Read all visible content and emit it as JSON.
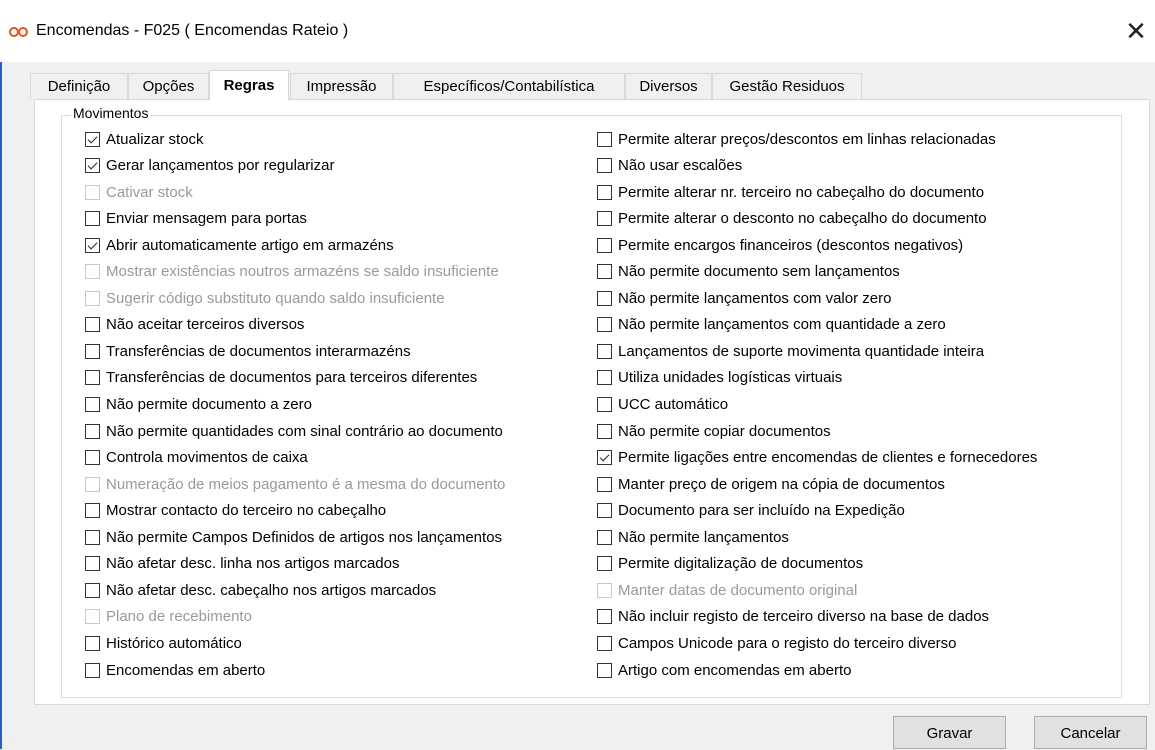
{
  "window": {
    "title": "Encomendas - F025 ( Encomendas Rateio )",
    "close_symbol": "✕"
  },
  "tabs": [
    {
      "label": "Definição",
      "active": false
    },
    {
      "label": "Opções",
      "active": false
    },
    {
      "label": "Regras",
      "active": true
    },
    {
      "label": "Impressão",
      "active": false
    },
    {
      "label": "Específicos/Contabilística",
      "active": false
    },
    {
      "label": "Diversos",
      "active": false
    },
    {
      "label": "Gestão Residuos",
      "active": false
    }
  ],
  "group": {
    "label": "Movimentos"
  },
  "left_options": [
    {
      "label": "Atualizar stock",
      "checked": true,
      "enabled": true
    },
    {
      "label": "Gerar lançamentos por regularizar",
      "checked": true,
      "enabled": true
    },
    {
      "label": "Cativar stock",
      "checked": false,
      "enabled": false
    },
    {
      "label": "Enviar mensagem para portas",
      "checked": false,
      "enabled": true
    },
    {
      "label": "Abrir automaticamente artigo em armazéns",
      "checked": true,
      "enabled": true
    },
    {
      "label": "Mostrar existências noutros armazéns se saldo insuficiente",
      "checked": false,
      "enabled": false
    },
    {
      "label": "Sugerir código substituto quando saldo insuficiente",
      "checked": false,
      "enabled": false
    },
    {
      "label": "Não aceitar terceiros diversos",
      "checked": false,
      "enabled": true
    },
    {
      "label": "Transferências de documentos interarmazéns",
      "checked": false,
      "enabled": true
    },
    {
      "label": "Transferências de documentos para terceiros diferentes",
      "checked": false,
      "enabled": true
    },
    {
      "label": "Não permite documento a zero",
      "checked": false,
      "enabled": true
    },
    {
      "label": "Não permite quantidades com sinal contrário ao documento",
      "checked": false,
      "enabled": true
    },
    {
      "label": "Controla movimentos de caixa",
      "checked": false,
      "enabled": true
    },
    {
      "label": "Numeração de meios pagamento é a mesma do documento",
      "checked": false,
      "enabled": false
    },
    {
      "label": "Mostrar contacto do terceiro no cabeçalho",
      "checked": false,
      "enabled": true
    },
    {
      "label": "Não permite Campos Definidos de artigos nos lançamentos",
      "checked": false,
      "enabled": true
    },
    {
      "label": "Não afetar desc. linha nos artigos marcados",
      "checked": false,
      "enabled": true
    },
    {
      "label": "Não afetar desc. cabeçalho nos artigos marcados",
      "checked": false,
      "enabled": true
    },
    {
      "label": "Plano de recebimento",
      "checked": false,
      "enabled": false
    },
    {
      "label": "Histórico automático",
      "checked": false,
      "enabled": true
    },
    {
      "label": "Encomendas em aberto",
      "checked": false,
      "enabled": true
    }
  ],
  "right_options": [
    {
      "label": "Permite alterar preços/descontos em linhas relacionadas",
      "checked": false,
      "enabled": true
    },
    {
      "label": "Não usar escalões",
      "checked": false,
      "enabled": true
    },
    {
      "label": "Permite alterar nr. terceiro  no cabeçalho do documento",
      "checked": false,
      "enabled": true
    },
    {
      "label": "Permite alterar o desconto no cabeçalho do documento",
      "checked": false,
      "enabled": true
    },
    {
      "label": "Permite encargos financeiros (descontos negativos)",
      "checked": false,
      "enabled": true
    },
    {
      "label": "Não permite documento sem lançamentos",
      "checked": false,
      "enabled": true
    },
    {
      "label": "Não permite lançamentos com valor zero",
      "checked": false,
      "enabled": true
    },
    {
      "label": "Não permite lançamentos com quantidade a zero",
      "checked": false,
      "enabled": true
    },
    {
      "label": "Lançamentos de suporte movimenta quantidade inteira",
      "checked": false,
      "enabled": true
    },
    {
      "label": "Utiliza unidades logísticas virtuais",
      "checked": false,
      "enabled": true
    },
    {
      "label": "UCC automático",
      "checked": false,
      "enabled": true
    },
    {
      "label": "Não permite copiar documentos",
      "checked": false,
      "enabled": true
    },
    {
      "label": "Permite ligações entre encomendas de clientes e fornecedores",
      "checked": true,
      "enabled": true
    },
    {
      "label": "Manter preço de origem na cópia de documentos",
      "checked": false,
      "enabled": true
    },
    {
      "label": "Documento para ser incluído na Expedição",
      "checked": false,
      "enabled": true
    },
    {
      "label": "Não permite lançamentos",
      "checked": false,
      "enabled": true
    },
    {
      "label": "Permite digitalização de documentos",
      "checked": false,
      "enabled": true
    },
    {
      "label": "Manter datas de documento original",
      "checked": false,
      "enabled": false
    },
    {
      "label": "Não incluir registo de terceiro diverso na base de dados",
      "checked": false,
      "enabled": true
    },
    {
      "label": "Campos Unicode para o registo do terceiro diverso",
      "checked": false,
      "enabled": true
    },
    {
      "label": "Artigo com encomendas em aberto",
      "checked": false,
      "enabled": true
    }
  ],
  "buttons": {
    "save_label": "Gravar",
    "cancel_label": "Cancelar"
  },
  "colors": {
    "accent": "#1c62c9",
    "app_icon": "#e8541a"
  }
}
